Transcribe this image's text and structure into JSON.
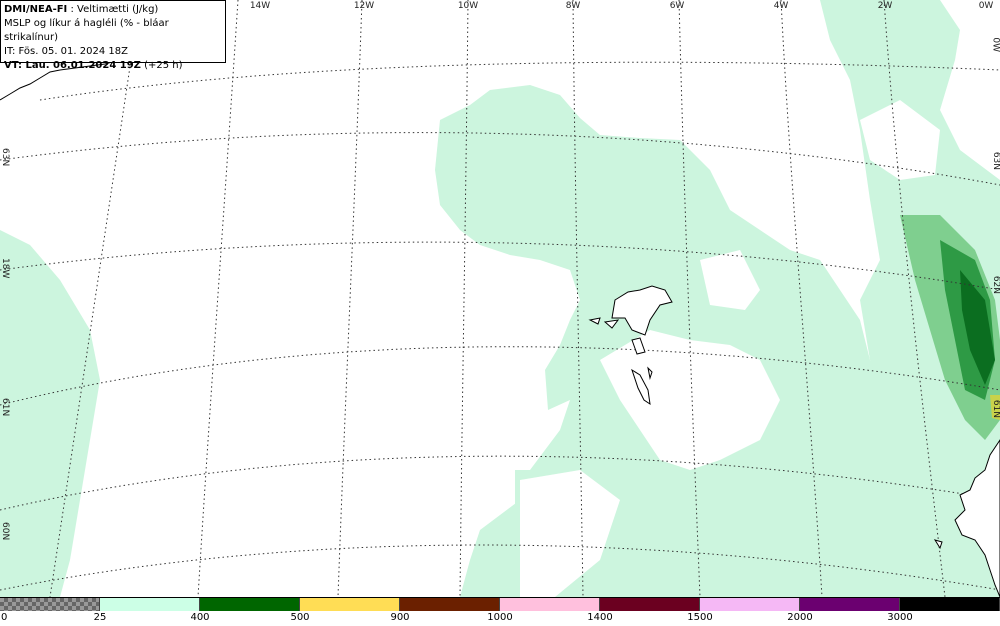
{
  "info": {
    "model": "DMI/NEA-FI",
    "param": ": Veltimætti (J/kg)",
    "line2": "MSLP og líkur á hagléli (% - bláar strikalínur)",
    "line3": "IT: Fös. 05. 01. 2024 18Z",
    "vt_label": "VT: Lau. 06.01.2024 19Z",
    "vt_offset": "(+25 h)"
  },
  "lon_labels": [
    "14W",
    "12W",
    "10W",
    "8W",
    "6W",
    "4W",
    "2W",
    "0W"
  ],
  "lat_labels_left": [
    "63N",
    "18W",
    "61N",
    "60N"
  ],
  "lat_labels_right": [
    "0W",
    "63N",
    "62N",
    "61N"
  ],
  "legend": {
    "colors": [
      "checker",
      "#ccffe6",
      "#006600",
      "#ffdd55",
      "#6b2000",
      "#ffc0dd",
      "#6b0020",
      "#f5b8f5",
      "#6b0070",
      "#000000"
    ],
    "ticks": [
      "0",
      "25",
      "400",
      "500",
      "900",
      "1000",
      "1400",
      "1500",
      "2000",
      "3000"
    ]
  }
}
